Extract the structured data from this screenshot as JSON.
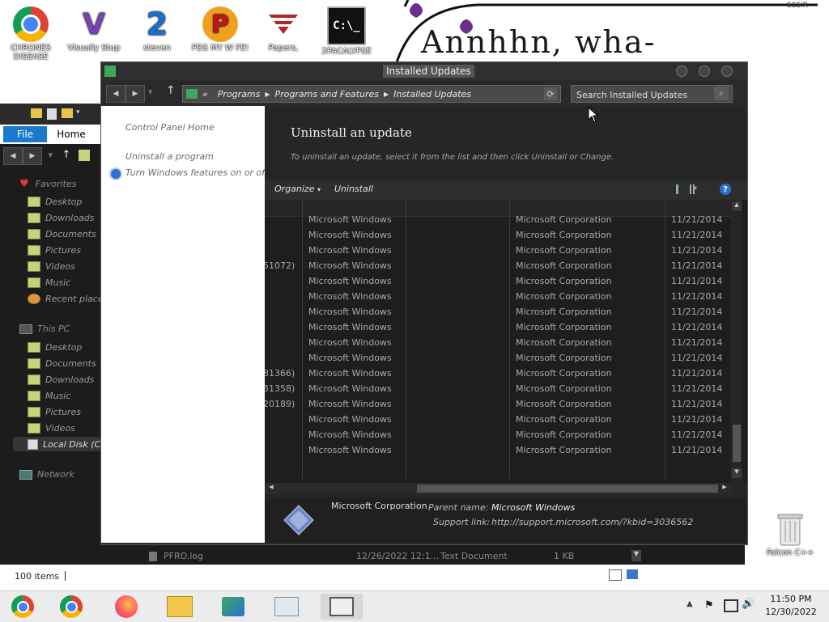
{
  "desktop": {
    "wallpaper_text": "Annhhn, wha-",
    "wallpaper_corner": "SSSIR",
    "icons": [
      {
        "label": "CHRONES DISEASE",
        "glyph": "",
        "color": "#dd3b2f"
      },
      {
        "label": "Visually Stup",
        "glyph": "V",
        "color": "#7b3fb6"
      },
      {
        "label": "steven",
        "glyph": "2",
        "color": "#1a6fd1"
      },
      {
        "label": "PEG MY W FE!",
        "glyph": "P",
        "color": "#f0a020"
      },
      {
        "label": "Papers,",
        "glyph": "",
        "color": "#b52222"
      },
      {
        "label": "2PACALYPSE",
        "glyph": "C:\\_",
        "color": "#111111"
      }
    ],
    "recycle_label": "Falcon C++"
  },
  "explorer": {
    "file_tab": "File",
    "home_tab": "Home",
    "favorites": "Favorites",
    "favorites_items": [
      "Desktop",
      "Downloads",
      "Documents",
      "Pictures",
      "Videos",
      "Music",
      "Recent places"
    ],
    "thispc": "This PC",
    "thispc_items": [
      "Desktop",
      "Documents",
      "Downloads",
      "Music",
      "Pictures",
      "Videos",
      "Local Disk (C:"
    ],
    "network": "Network",
    "status_items": "100 items",
    "bg_file": {
      "name": "PFRO.log",
      "date": "12/26/2022 12:1...",
      "type": "Text Document",
      "size": "1 KB"
    }
  },
  "window": {
    "title": "Installed Updates",
    "breadcrumb": [
      "«",
      "Programs",
      "Programs and Features",
      "Installed Updates"
    ],
    "search_placeholder": "Search Installed Updates",
    "leftpane": {
      "home": "Control Panel Home",
      "uninstall_program": "Uninstall a program",
      "features": "Turn Windows features on or off"
    },
    "heading": "Uninstall an update",
    "description": "To uninstall an update, select it from the list and then click Uninstall or Change.",
    "toolbar": {
      "organize": "Organize",
      "uninstall": "Uninstall",
      "help": "?"
    },
    "rows": [
      {
        "name": "",
        "program": "Microsoft Windows",
        "publisher": "Microsoft Corporation",
        "date": "11/21/2014"
      },
      {
        "name": "",
        "program": "Microsoft Windows",
        "publisher": "Microsoft Corporation",
        "date": "11/21/2014"
      },
      {
        "name": "",
        "program": "Microsoft Windows",
        "publisher": "Microsoft Corporation",
        "date": "11/21/2014"
      },
      {
        "name": "51072)",
        "program": "Microsoft Windows",
        "publisher": "Microsoft Corporation",
        "date": "11/21/2014"
      },
      {
        "name": "",
        "program": "Microsoft Windows",
        "publisher": "Microsoft Corporation",
        "date": "11/21/2014"
      },
      {
        "name": "",
        "program": "Microsoft Windows",
        "publisher": "Microsoft Corporation",
        "date": "11/21/2014"
      },
      {
        "name": "",
        "program": "Microsoft Windows",
        "publisher": "Microsoft Corporation",
        "date": "11/21/2014"
      },
      {
        "name": "",
        "program": "Microsoft Windows",
        "publisher": "Microsoft Corporation",
        "date": "11/21/2014"
      },
      {
        "name": "",
        "program": "Microsoft Windows",
        "publisher": "Microsoft Corporation",
        "date": "11/21/2014"
      },
      {
        "name": "",
        "program": "Microsoft Windows",
        "publisher": "Microsoft Corporation",
        "date": "11/21/2014"
      },
      {
        "name": "81366)",
        "program": "Microsoft Windows",
        "publisher": "Microsoft Corporation",
        "date": "11/21/2014"
      },
      {
        "name": "31358)",
        "program": "Microsoft Windows",
        "publisher": "Microsoft Corporation",
        "date": "11/21/2014"
      },
      {
        "name": "20189)",
        "program": "Microsoft Windows",
        "publisher": "Microsoft Corporation",
        "date": "11/21/2014"
      },
      {
        "name": "",
        "program": "Microsoft Windows",
        "publisher": "Microsoft Corporation",
        "date": "11/21/2014"
      },
      {
        "name": "",
        "program": "Microsoft Windows",
        "publisher": "Microsoft Corporation",
        "date": "11/21/2014"
      },
      {
        "name": "",
        "program": "Microsoft Windows",
        "publisher": "Microsoft Corporation",
        "date": "11/21/2014"
      }
    ],
    "details": {
      "publisher": "Microsoft Corporation",
      "parent_label": "Parent name:",
      "parent_value": "Microsoft Windows",
      "support_label": "Support link:",
      "support_value": "http://support.microsoft.com/?kbid=3036562"
    }
  },
  "taskbar": {
    "time": "11:50 PM",
    "date": "12/30/2022"
  }
}
